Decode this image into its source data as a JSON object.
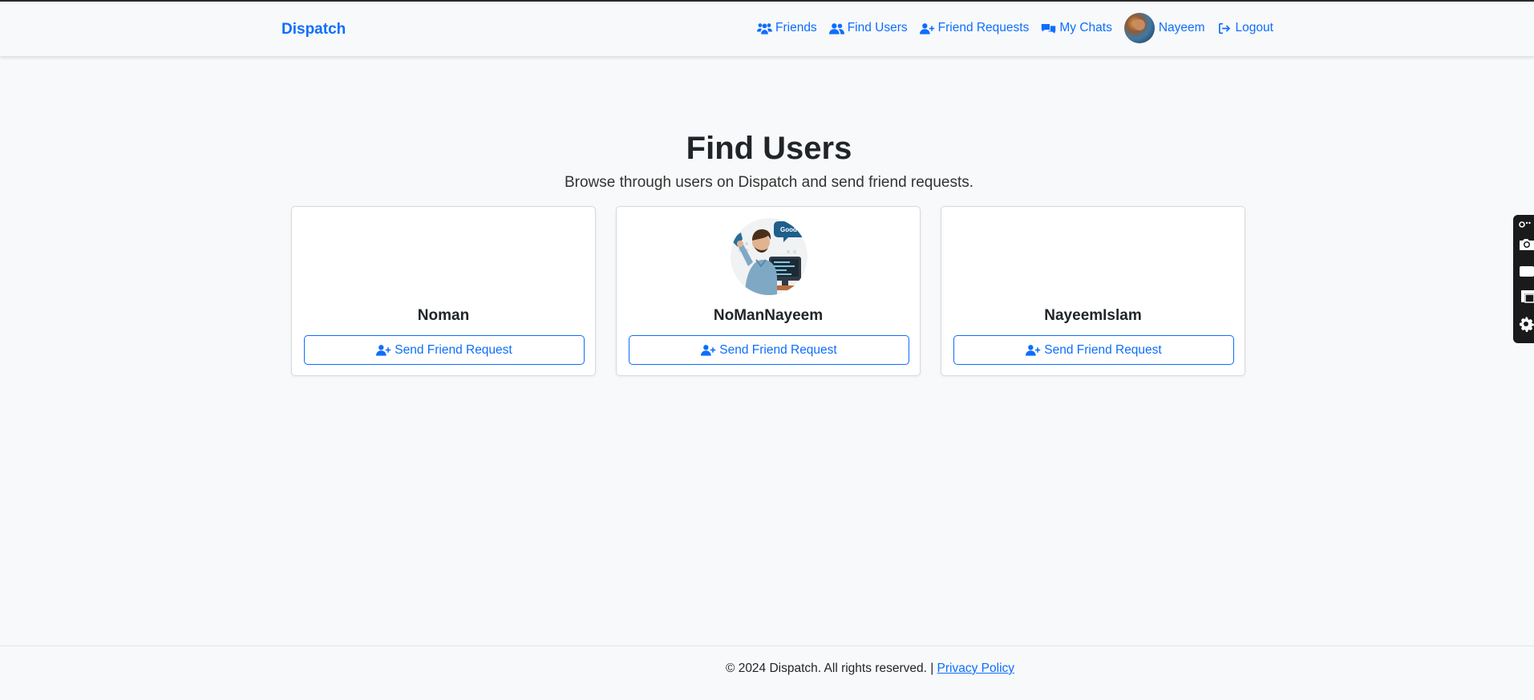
{
  "brand": "Dispatch",
  "nav": {
    "friends": "Friends",
    "find_users": "Find Users",
    "friend_requests": "Friend Requests",
    "my_chats": "My Chats",
    "user_name": "Nayeem",
    "logout": "Logout"
  },
  "page": {
    "title": "Find Users",
    "subtitle": "Browse through users on Dispatch and send friend requests."
  },
  "users": [
    {
      "name": "Noman",
      "has_avatar": false,
      "button_label": "Send Friend Request"
    },
    {
      "name": "NoManNayeem",
      "has_avatar": true,
      "avatar_bubble": "Good B...",
      "button_label": "Send Friend Request"
    },
    {
      "name": "NayeemIslam",
      "has_avatar": false,
      "button_label": "Send Friend Request"
    }
  ],
  "footer": {
    "copyright": "© 2024 Dispatch. All rights reserved. |",
    "privacy_link": "Privacy Policy"
  },
  "colors": {
    "accent": "#0d6efd",
    "page_background": "#f8f9fa",
    "text": "#212529"
  },
  "icons": [
    "users-icon",
    "user-group-icon",
    "user-plus-icon",
    "chat-icon",
    "logout-icon",
    "camera-icon",
    "video-icon",
    "screen-icon",
    "gear-icon"
  ]
}
